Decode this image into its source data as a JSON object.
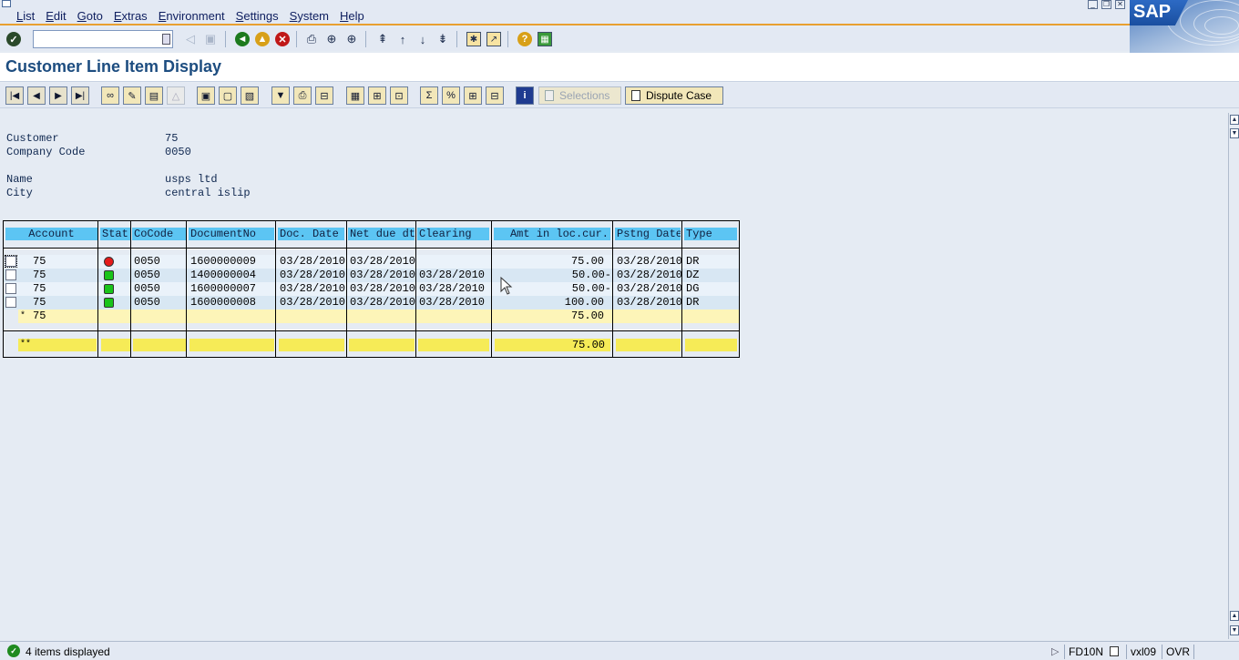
{
  "menubar": {
    "items": [
      "List",
      "Edit",
      "Goto",
      "Extras",
      "Environment",
      "Settings",
      "System",
      "Help"
    ],
    "logo_text": "SAP"
  },
  "standard_toolbar": {
    "command_field_value": ""
  },
  "page": {
    "title": "Customer Line Item Display"
  },
  "app_toolbar": {
    "selections_label": "Selections",
    "dispute_case_label": "Dispute Case"
  },
  "header_fields": [
    {
      "label": "Customer",
      "value": "75"
    },
    {
      "label": "Company Code",
      "value": "0050"
    },
    {
      "label": "Name",
      "value": "usps ltd"
    },
    {
      "label": "City",
      "value": "central islip"
    }
  ],
  "table": {
    "columns": [
      "Account",
      "Stat",
      "CoCode",
      "DocumentNo",
      "Doc. Date",
      "Net due dt",
      "Clearing",
      "Amt in loc.cur.",
      "Pstng Date",
      "Type"
    ],
    "rows": [
      {
        "account": "75",
        "status": "red",
        "cocode": "0050",
        "docno": "1600000009",
        "doc_date": "03/28/2010",
        "net_due": "03/28/2010",
        "clearing": "",
        "amount": "75.00",
        "pstng_date": "03/28/2010",
        "type": "DR"
      },
      {
        "account": "75",
        "status": "green",
        "cocode": "0050",
        "docno": "1400000004",
        "doc_date": "03/28/2010",
        "net_due": "03/28/2010",
        "clearing": "03/28/2010",
        "amount": "50.00-",
        "pstng_date": "03/28/2010",
        "type": "DZ"
      },
      {
        "account": "75",
        "status": "green",
        "cocode": "0050",
        "docno": "1600000007",
        "doc_date": "03/28/2010",
        "net_due": "03/28/2010",
        "clearing": "03/28/2010",
        "amount": "50.00-",
        "pstng_date": "03/28/2010",
        "type": "DG"
      },
      {
        "account": "75",
        "status": "green",
        "cocode": "0050",
        "docno": "1600000008",
        "doc_date": "03/28/2010",
        "net_due": "03/28/2010",
        "clearing": "03/28/2010",
        "amount": "100.00",
        "pstng_date": "03/28/2010",
        "type": "DR"
      }
    ],
    "subtotal": {
      "marker": "*",
      "account": "75",
      "amount": "75.00"
    },
    "total": {
      "marker": "**",
      "amount": "75.00"
    }
  },
  "statusbar": {
    "message": "4 items displayed",
    "transaction": "FD10N",
    "server": "vxl09",
    "mode": "OVR"
  },
  "colors": {
    "header_cell": "#5cc5f3",
    "subtotal_row": "#fdf5b8",
    "total_row": "#f6eb57",
    "title_text": "#1d4d80",
    "status_red": "#e51a1a",
    "status_green": "#19c419"
  }
}
